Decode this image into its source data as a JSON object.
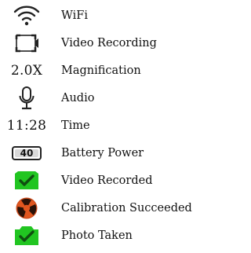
{
  "legend": {
    "items": [
      {
        "icon": "wifi-icon",
        "label": "WiFi"
      },
      {
        "icon": "video-camera-icon",
        "label": "Video Recording"
      },
      {
        "icon": "magnification-text",
        "icon_text": "2.0X",
        "label": "Magnification"
      },
      {
        "icon": "microphone-icon",
        "label": "Audio"
      },
      {
        "icon": "time-text",
        "icon_text": "11:28",
        "label": "Time"
      },
      {
        "icon": "battery-icon",
        "icon_text": "40",
        "label": "Battery Power"
      },
      {
        "icon": "video-recorded-check-icon",
        "label": "Video Recorded"
      },
      {
        "icon": "calibration-success-icon",
        "label": "Calibration Succeeded"
      },
      {
        "icon": "photo-taken-check-icon",
        "label": "Photo Taken"
      }
    ]
  },
  "colors": {
    "check_green": "#21c521",
    "check_mark": "#0f4f10",
    "calibration_orange": "#e0561f",
    "icon_dark": "#222222"
  }
}
